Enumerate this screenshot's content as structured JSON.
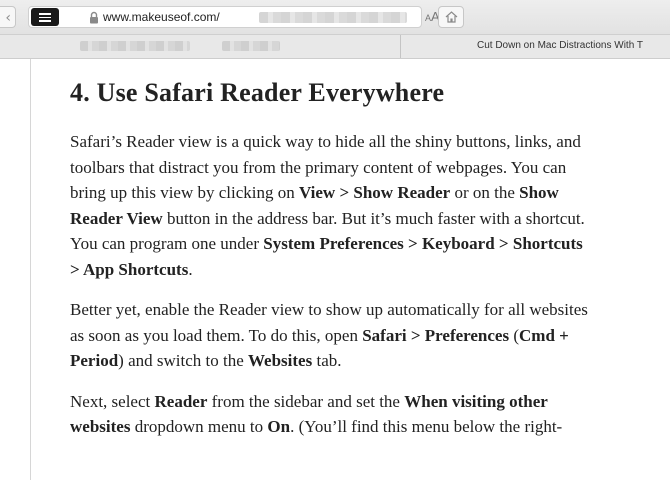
{
  "toolbar": {
    "back_glyph": "‹",
    "reader_icon": "reader-view-icon",
    "lock_icon": "lock-icon",
    "url": "www.makeuseof.com/",
    "text_size_small": "A",
    "text_size_large": "A",
    "home_icon": "home-icon"
  },
  "tab": {
    "title": "Cut Down on Mac Distractions With T"
  },
  "article": {
    "heading": "4. Use Safari Reader Everywhere",
    "p1": {
      "l1": "Safari’s Reader view is a quick way to hide all the shiny buttons, links, and",
      "l2": "toolbars that distract you from the primary content of webpages. You can",
      "l3a": "bring up this view by clicking on ",
      "l3b": "View > Show Reader",
      "l3c": " or on the ",
      "l3d": "Show",
      "l4a": "Reader View",
      "l4b": " button in the address bar. But it’s much faster with a shortcut.",
      "l5a": "You can program one under ",
      "l5b": "System Preferences > Keyboard > Shortcuts",
      "l6a": "> App Shortcuts",
      "l6b": "."
    },
    "p2": {
      "l1": "Better yet, enable the Reader view to show up automatically for all websites",
      "l2a": "as soon as you load them. To do this, open ",
      "l2b": "Safari > Preferences",
      "l2c": " (",
      "l2d": "Cmd +",
      "l3a": "Period",
      "l3b": ") and switch to the ",
      "l3c": "Websites",
      "l3d": " tab."
    },
    "p3": {
      "l1a": "Next, select ",
      "l1b": "Reader",
      "l1c": " from the sidebar and set the ",
      "l1d": "When visiting other",
      "l2a": "websites",
      "l2b": " dropdown menu to ",
      "l2c": "On",
      "l2d": ". (You’ll find this menu below the right-"
    }
  }
}
